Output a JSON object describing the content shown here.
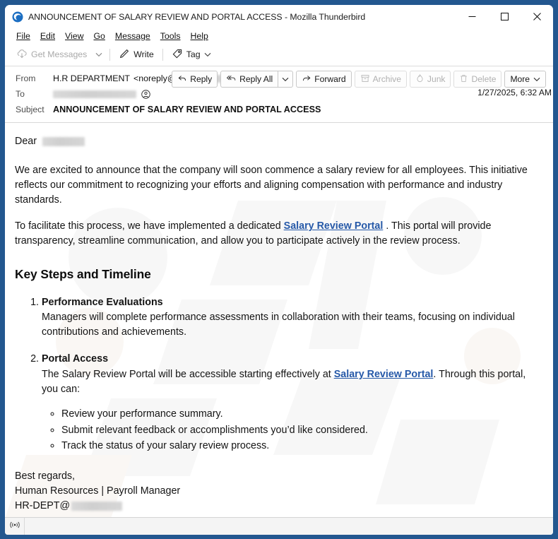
{
  "window": {
    "title": "ANNOUNCEMENT OF SALARY REVIEW AND PORTAL ACCESS - Mozilla Thunderbird",
    "app_icon": "thunderbird-icon",
    "controls": {
      "minimize": "minimize-icon",
      "maximize": "maximize-icon",
      "close": "close-icon"
    },
    "border_color": "#23578f"
  },
  "menubar": {
    "items": [
      {
        "label": "File",
        "accel": "F"
      },
      {
        "label": "Edit",
        "accel": "E"
      },
      {
        "label": "View",
        "accel": "V"
      },
      {
        "label": "Go",
        "accel": "G"
      },
      {
        "label": "Message",
        "accel": "M"
      },
      {
        "label": "Tools",
        "accel": "T"
      },
      {
        "label": "Help",
        "accel": "H"
      }
    ]
  },
  "toolbar": {
    "get_messages": "Get Messages",
    "write": "Write",
    "tag": "Tag"
  },
  "header": {
    "from_label": "From",
    "from_name": "H.R DEPARTMENT",
    "from_address_open": "<noreply@",
    "from_address_close": ">",
    "to_label": "To",
    "subject_label": "Subject",
    "subject_value": "ANNOUNCEMENT OF SALARY REVIEW AND PORTAL ACCESS",
    "date": "1/27/2025, 6:32 AM",
    "actions": {
      "reply": "Reply",
      "reply_all": "Reply All",
      "forward": "Forward",
      "archive": "Archive",
      "junk": "Junk",
      "delete": "Delete",
      "more": "More"
    }
  },
  "body": {
    "greeting": "Dear",
    "paragraph1": "We are excited to announce that the company will soon commence a salary review for all employees. This initiative reflects our commitment to recognizing your efforts and aligning compensation with performance and industry standards.",
    "paragraph2_before": "To facilitate this process, we have implemented a dedicated ",
    "paragraph2_link": "Salary Review Portal",
    "paragraph2_after": " . This portal will provide transparency, streamline communication, and allow you to participate actively in the review process.",
    "heading": "Key Steps and Timeline",
    "steps": [
      {
        "title": "Performance Evaluations",
        "text": "Managers will complete performance assessments in collaboration with their teams, focusing on individual contributions and achievements."
      },
      {
        "title": "Portal Access",
        "text_before": "The Salary Review Portal will be accessible starting effectively at ",
        "link": "Salary Review Portal",
        "text_after": ". Through this portal, you can:",
        "sub_items": [
          "Review your performance summary.",
          "Submit relevant feedback or accomplishments you’d like considered.",
          "Track the status of your salary review process."
        ]
      }
    ],
    "signature_line1": "Best regards,",
    "signature_line2": "Human Resources | Payroll Manager",
    "signature_line3": "HR-DEPT@",
    "link_color": "#2659a8"
  },
  "statusbar": {
    "offline_icon": "offline-broadcast-icon"
  }
}
